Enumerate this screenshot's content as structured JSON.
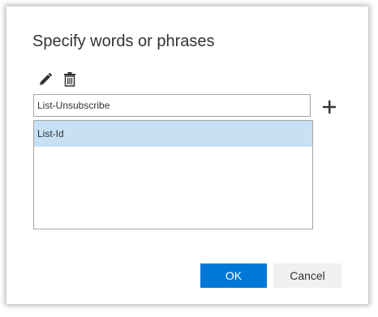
{
  "dialog": {
    "title": "Specify words or phrases",
    "input_value": "List-Unsubscribe",
    "list_items": [
      "List-Id"
    ],
    "ok_label": "OK",
    "cancel_label": "Cancel"
  },
  "icons": {
    "edit": "pencil-icon",
    "delete": "trash-icon",
    "add": "plus-icon"
  },
  "colors": {
    "accent": "#0078d7",
    "selected_row": "#c7e0f4"
  }
}
